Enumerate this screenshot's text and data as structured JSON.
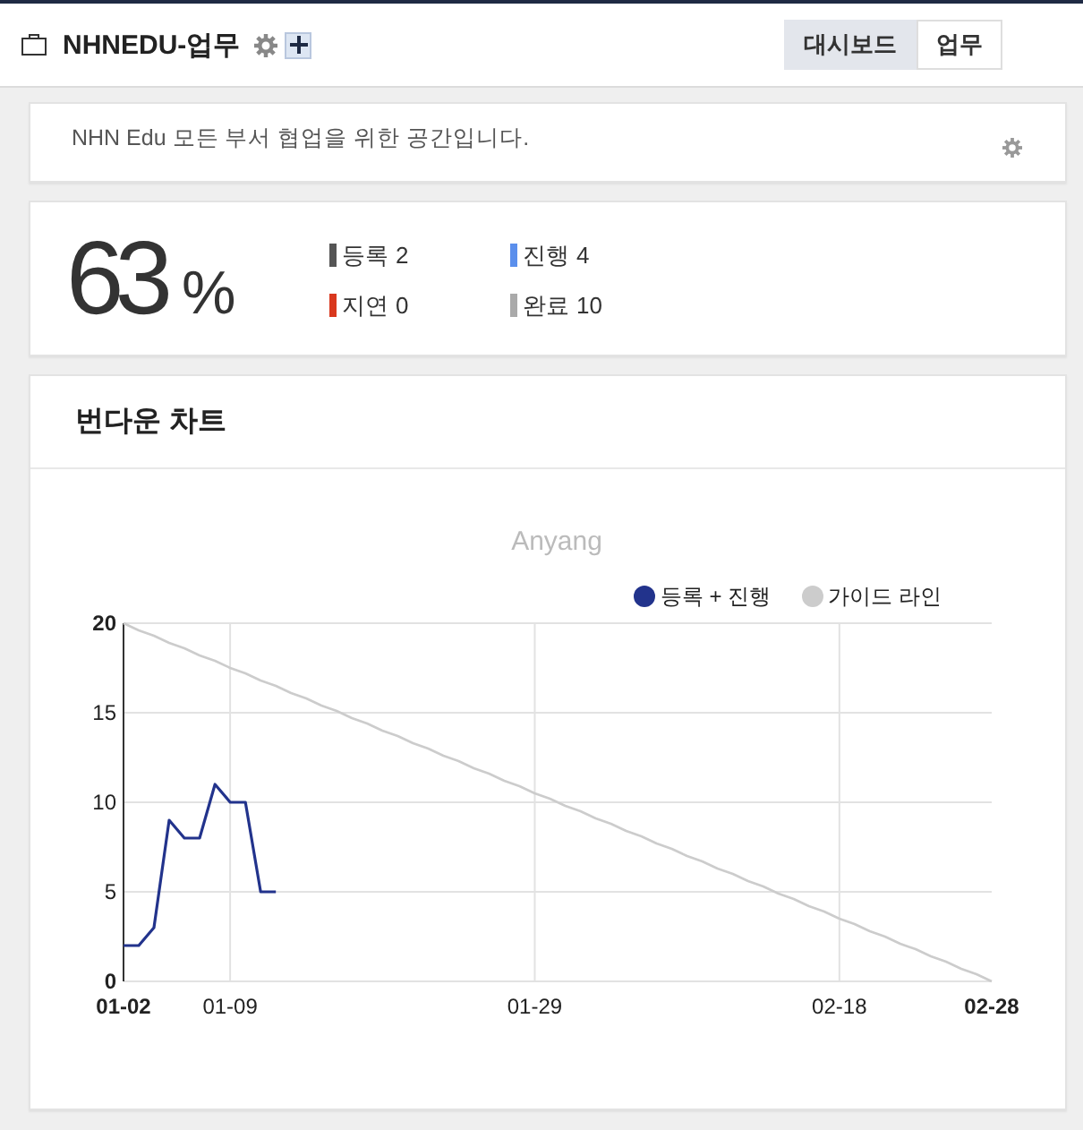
{
  "header": {
    "title": "NHNEDU-업무",
    "tabs": [
      {
        "label": "대시보드",
        "selected": true
      },
      {
        "label": "업무",
        "selected": false
      }
    ]
  },
  "description": {
    "text": "NHN Edu 모든 부서 협업을 위한 공간입니다."
  },
  "summary": {
    "percent": "63",
    "unit": "%",
    "statuses": [
      {
        "label": "등록",
        "count": "2",
        "color": "#555555"
      },
      {
        "label": "진행",
        "count": "4",
        "color": "#5b8fec"
      },
      {
        "label": "지연",
        "count": "0",
        "color": "#d9381e"
      },
      {
        "label": "완료",
        "count": "10",
        "color": "#aaaaaa"
      }
    ]
  },
  "burndown": {
    "title": "번다운 차트",
    "chart_data": {
      "type": "line",
      "title": "Anyang",
      "categories": [
        "01-02",
        null,
        null,
        null,
        null,
        null,
        null,
        "01-09",
        null,
        null,
        null,
        null,
        null,
        null,
        null,
        null,
        null,
        null,
        null,
        null,
        null,
        null,
        null,
        null,
        null,
        null,
        null,
        "01-29",
        null,
        null,
        null,
        null,
        null,
        null,
        null,
        null,
        null,
        null,
        null,
        null,
        null,
        null,
        null,
        null,
        null,
        null,
        null,
        "02-18",
        null,
        null,
        null,
        null,
        null,
        null,
        null,
        null,
        null,
        "02-28"
      ],
      "series": [
        {
          "name": "등록 + 진행",
          "color": "#22338c",
          "values": [
            2,
            2,
            3,
            9,
            8,
            8,
            11,
            10,
            10,
            5,
            5,
            null,
            null,
            null,
            null,
            null,
            null,
            null,
            null,
            null,
            null,
            null,
            null,
            null,
            null,
            null,
            null,
            null,
            null,
            null,
            null,
            null,
            null,
            null,
            null,
            null,
            null,
            null,
            null,
            null,
            null,
            null,
            null,
            null,
            null,
            null,
            null,
            null,
            null,
            null,
            null,
            null,
            null,
            null,
            null,
            null,
            null,
            null
          ]
        },
        {
          "name": "가이드 라인",
          "color": "#cccccc",
          "values": [
            20,
            19.6,
            19.3,
            18.9,
            18.6,
            18.2,
            17.9,
            17.5,
            17.2,
            16.8,
            16.5,
            16.1,
            15.8,
            15.4,
            15.1,
            14.7,
            14.4,
            14,
            13.7,
            13.3,
            13,
            12.6,
            12.3,
            11.9,
            11.6,
            11.2,
            10.9,
            10.5,
            10.2,
            9.8,
            9.5,
            9.1,
            8.8,
            8.4,
            8.1,
            7.7,
            7.4,
            7,
            6.7,
            6.3,
            6,
            5.6,
            5.3,
            4.9,
            4.6,
            4.2,
            3.9,
            3.5,
            3.2,
            2.8,
            2.5,
            2.1,
            1.8,
            1.4,
            1.1,
            0.7,
            0.4,
            0
          ]
        }
      ],
      "ylim": [
        0,
        20
      ],
      "yticks": [
        0,
        5,
        10,
        15,
        20
      ],
      "grid": true,
      "legend": "top-right"
    }
  }
}
